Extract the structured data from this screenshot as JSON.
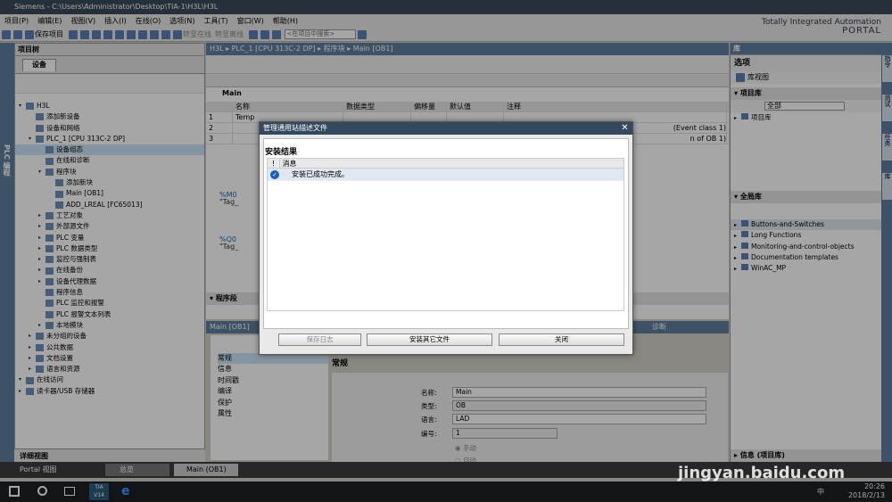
{
  "window": {
    "title": "Siemens  -  C:\\Users\\Administrator\\Desktop\\TIA-1\\H3L\\H3L"
  },
  "menu": [
    "项目(P)",
    "编辑(E)",
    "视图(V)",
    "插入(I)",
    "在线(O)",
    "选项(N)",
    "工具(T)",
    "窗口(W)",
    "帮助(H)"
  ],
  "toolbar": {
    "save_project": "保存项目",
    "go_online": "转至在线",
    "go_offline": "转至离线",
    "search_placeholder": "<在项目中搜索>"
  },
  "brand": {
    "line1": "Totally Integrated Automation",
    "line2": "PORTAL"
  },
  "left_strip_label": "PLC 编程",
  "project_tree": {
    "title": "项目树",
    "tab": "设备",
    "items": [
      {
        "label": "H3L",
        "level": 0
      },
      {
        "label": "添加新设备",
        "level": 1
      },
      {
        "label": "设备和网络",
        "level": 1
      },
      {
        "label": "PLC_1 [CPU 313C-2 DP]",
        "level": 1
      },
      {
        "label": "设备组态",
        "level": 2
      },
      {
        "label": "在线和诊断",
        "level": 2
      },
      {
        "label": "程序块",
        "level": 2
      },
      {
        "label": "添加新块",
        "level": 3
      },
      {
        "label": "Main [OB1]",
        "level": 3
      },
      {
        "label": "ADD_LREAL [FC65013]",
        "level": 3
      },
      {
        "label": "工艺对象",
        "level": 2
      },
      {
        "label": "外部源文件",
        "level": 2
      },
      {
        "label": "PLC 变量",
        "level": 2
      },
      {
        "label": "PLC 数据类型",
        "level": 2
      },
      {
        "label": "监控与强制表",
        "level": 2
      },
      {
        "label": "在线备份",
        "level": 2
      },
      {
        "label": "设备代理数据",
        "level": 2
      },
      {
        "label": "程序信息",
        "level": 2
      },
      {
        "label": "PLC 监控和报警",
        "level": 2
      },
      {
        "label": "PLC 报警文本列表",
        "level": 2
      },
      {
        "label": "本地模块",
        "level": 2
      },
      {
        "label": "未分组的设备",
        "level": 1
      },
      {
        "label": "公共数据",
        "level": 1
      },
      {
        "label": "文档设置",
        "level": 1
      },
      {
        "label": "语言和资源",
        "level": 1
      },
      {
        "label": "在线访问",
        "level": 0
      },
      {
        "label": "读卡器/USB 存储器",
        "level": 0
      }
    ],
    "detail_view": "详细视图"
  },
  "editor": {
    "breadcrumb": "H3L  ▸  PLC_1 [CPU 313C-2 DP]  ▸  程序块  ▸  Main [OB1]",
    "block_name": "Main",
    "columns": [
      "名称",
      "数据类型",
      "偏移量",
      "默认值",
      "注释"
    ],
    "rows": [
      {
        "num": "1",
        "name": "Temp",
        "comment": ""
      },
      {
        "num": "2",
        "name": "",
        "comment": "(Event class 1)"
      },
      {
        "num": "3",
        "name": "",
        "comment": "n of OB 1)"
      }
    ],
    "network_section": "程序段",
    "tag1": "%M0",
    "tag1_name": "\"Tag_",
    "tag2": "%Q0",
    "tag2_name": "\"Tag_"
  },
  "properties": {
    "header": "Main [OB1]",
    "diagnostics_tab": "诊断",
    "tab": "常规",
    "nav": [
      "常规",
      "信息",
      "时间戳",
      "编译",
      "保护",
      "属性"
    ],
    "section_title": "常规",
    "fields": [
      {
        "label": "名称:",
        "value": "Main"
      },
      {
        "label": "类型:",
        "value": "OB"
      },
      {
        "label": "语言:",
        "value": "LAD"
      },
      {
        "label": "编号:",
        "value": "1"
      }
    ],
    "radio_manual": "手动",
    "radio_auto": "自动"
  },
  "library": {
    "header": "库",
    "options": "选项",
    "lib_view": "库视图",
    "project_library": "项目库",
    "filter": "全部",
    "project_library_item": "项目库",
    "global_library": "全局库",
    "global_items": [
      "Buttons-and-Switches",
      "Long Functions",
      "Monitoring-and-control-objects",
      "Documentation templates",
      "WinAC_MP"
    ],
    "info": "信息 (项目库)"
  },
  "right_tabs": [
    "指令",
    "测试",
    "任务",
    "库"
  ],
  "portal_bar": {
    "portal": "Portal 视图",
    "tab1": "总览",
    "tab2": "Main (OB1)"
  },
  "dialog": {
    "title": "管理通用站描述文件",
    "heading": "安装结果",
    "column": "消息",
    "message": "安装已成功完成。",
    "buttons": [
      "保存日志",
      "安装其它文件",
      "关闭"
    ]
  },
  "taskbar": {
    "time": "20:26",
    "date": "2018/2/13",
    "app": "TIA V14",
    "ime": "中"
  },
  "watermark": "jingyan.baidu.com"
}
